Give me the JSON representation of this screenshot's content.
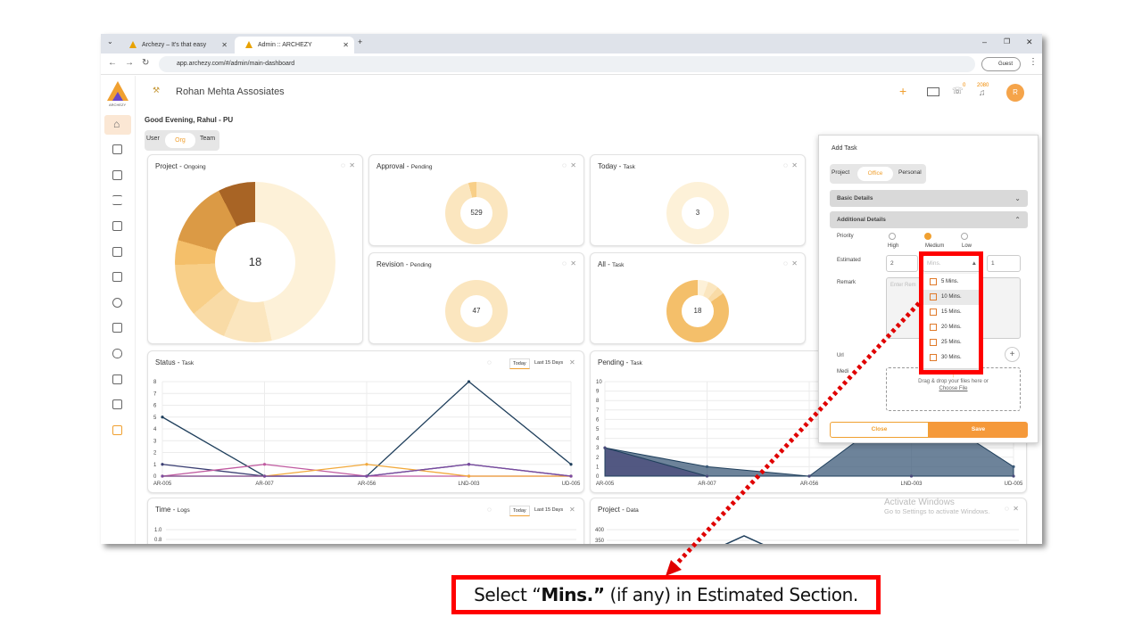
{
  "browser": {
    "tabs": [
      {
        "label": "Archezy – It's that easy"
      },
      {
        "label": "Admin :: ARCHEZY"
      }
    ],
    "url": "app.archezy.com/#/admin/main-dashboard",
    "guest_label": "Guest"
  },
  "app": {
    "brand_text": "ARCHEZY",
    "org_name": "Rohan Mehta Assosiates",
    "notif_count_1": "0",
    "notif_count_2": "2080",
    "avatar_letter": "R",
    "greeting": "Good Evening, Rahul - PU",
    "view_tabs": [
      "User",
      "Org",
      "Team"
    ],
    "active_view": "Org"
  },
  "cards": {
    "project_ongoing": {
      "title": "Project - ",
      "sub": "Ongoing",
      "center": "18"
    },
    "approval": {
      "title": "Approval - ",
      "sub": "Pending",
      "center": "529"
    },
    "today_task": {
      "title": "Today - ",
      "sub": "Task",
      "center": "3"
    },
    "revision": {
      "title": "Revision - ",
      "sub": "Pending",
      "center": "47"
    },
    "all_task": {
      "title": "All - ",
      "sub": "Task",
      "center": "18"
    },
    "status_task": {
      "title": "Status - ",
      "sub": "Task",
      "tab_today": "Today",
      "tab_last": "Last 15 Days"
    },
    "pending_task": {
      "title": "Pending - ",
      "sub": "Task"
    },
    "time_logs": {
      "title": "Time - ",
      "sub": "Logs",
      "tab_today": "Today",
      "tab_last": "Last 15 Days"
    },
    "project_data": {
      "title": "Project - ",
      "sub": "Data"
    }
  },
  "chart_data": [
    {
      "type": "line",
      "title": "Status - Task",
      "categories": [
        "AR-005",
        "AR-007",
        "AR-056",
        "LND-003",
        "UD-005"
      ],
      "ylim": [
        0,
        8
      ],
      "yticks": [
        "0",
        "1",
        "2",
        "3",
        "4",
        "5",
        "6",
        "7",
        "8"
      ],
      "series": [
        {
          "color": "#1f3f5c",
          "values": [
            5,
            0,
            0,
            8,
            1
          ]
        },
        {
          "color": "#3b3f73",
          "values": [
            1,
            0,
            0,
            1,
            0
          ]
        },
        {
          "color": "#c05aa0",
          "values": [
            0,
            1,
            0,
            0,
            0
          ]
        },
        {
          "color": "#f2a93b",
          "values": [
            0,
            0,
            1,
            0,
            0
          ]
        },
        {
          "color": "#7a4aa0",
          "values": [
            0,
            0,
            0,
            1,
            0
          ]
        }
      ]
    },
    {
      "type": "area",
      "title": "Pending - Task",
      "categories": [
        "AR-005",
        "AR-007",
        "AR-056",
        "LND-003",
        "UD-005"
      ],
      "ylim": [
        0,
        10
      ],
      "yticks": [
        "0",
        "1",
        "2",
        "3",
        "4",
        "5",
        "6",
        "7",
        "8",
        "9",
        "10"
      ],
      "series": [
        {
          "color": "#3c5a78",
          "values": [
            3,
            1,
            0,
            8,
            1
          ]
        },
        {
          "color": "#4a4a7a",
          "values": [
            3,
            0,
            0,
            0,
            0
          ]
        }
      ]
    },
    {
      "type": "line",
      "title": "Time - Logs",
      "yticks": [
        "1.0",
        "0.8"
      ]
    },
    {
      "type": "line",
      "title": "Project - Data",
      "yticks": [
        "400",
        "350"
      ]
    }
  ],
  "add_task": {
    "title": "Add Task",
    "tabs": [
      "Project",
      "Office",
      "Personal"
    ],
    "active_tab": "Office",
    "section_basic": "Basic Details",
    "section_additional": "Additional Details",
    "priority_label": "Priority",
    "priority_options": [
      "High",
      "Medium",
      "Low"
    ],
    "priority_selected": "Medium",
    "estimated_label": "Estimated",
    "estimated_value": "2",
    "estimated_unit_placeholder": "Mins.",
    "estimated_right_value": "1",
    "remark_label": "Remark",
    "remark_placeholder": "Enter Rem",
    "url_label": "Url",
    "media_label": "Medi",
    "drop_text": "Drag & drop your files here or",
    "choose_file": "Choose File",
    "close_label": "Close",
    "save_label": "Save",
    "mins_options": [
      "5 Mins.",
      "10 Mins.",
      "15 Mins.",
      "20 Mins.",
      "25 Mins.",
      "30 Mins."
    ],
    "mins_highlighted": "10 Mins."
  },
  "watermark": {
    "line1": "Activate Windows",
    "line2": "Go to Settings to activate Windows."
  },
  "callout": {
    "pre": "Select “",
    "bold": "Mins.”",
    "post": " (if any) in Estimated Section."
  },
  "colors": {
    "accent": "#f0a030",
    "annotation_red": "#ff0000"
  }
}
